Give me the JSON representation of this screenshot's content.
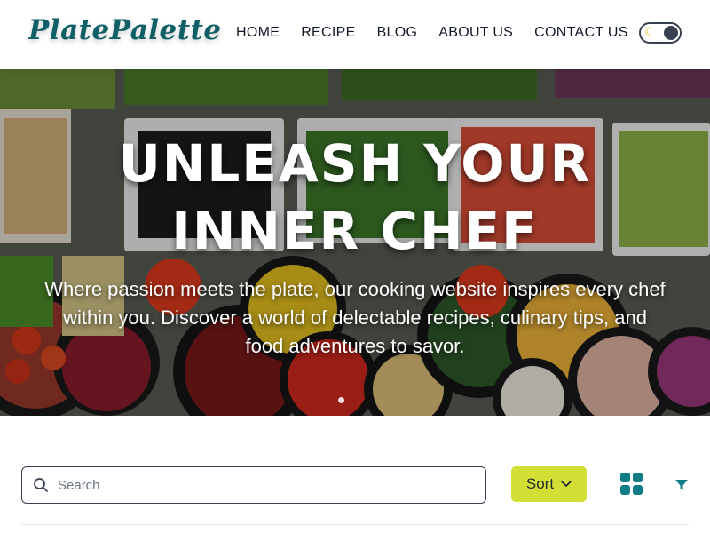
{
  "brand": {
    "logo_text": "PlatePalette",
    "logo_color": "#0f5f66"
  },
  "nav": {
    "items": [
      {
        "label": "HOME"
      },
      {
        "label": "RECIPE"
      },
      {
        "label": "BLOG"
      },
      {
        "label": "ABOUT US"
      },
      {
        "label": "CONTACT US"
      }
    ]
  },
  "theme_toggle": {
    "icon": "moon-icon",
    "state": "dark-mode-off"
  },
  "hero": {
    "title_line1": "UNLEASH YOUR",
    "title_line2": "INNER CHEF",
    "subtitle": "Where passion meets the plate, our cooking website inspires every chef within you. Discover a world of delectable recipes, culinary tips, and food adventures to savor.",
    "background": "salad-bar-ingredients-photo",
    "carousel_dots": 1
  },
  "toolbar": {
    "search_placeholder": "Search",
    "search_value": "",
    "sort_label": "Sort",
    "sort_color": "#d4df35",
    "view_icon": "grid-view-icon",
    "filter_icon": "filter-icon",
    "accent_color": "#0e7d86"
  }
}
